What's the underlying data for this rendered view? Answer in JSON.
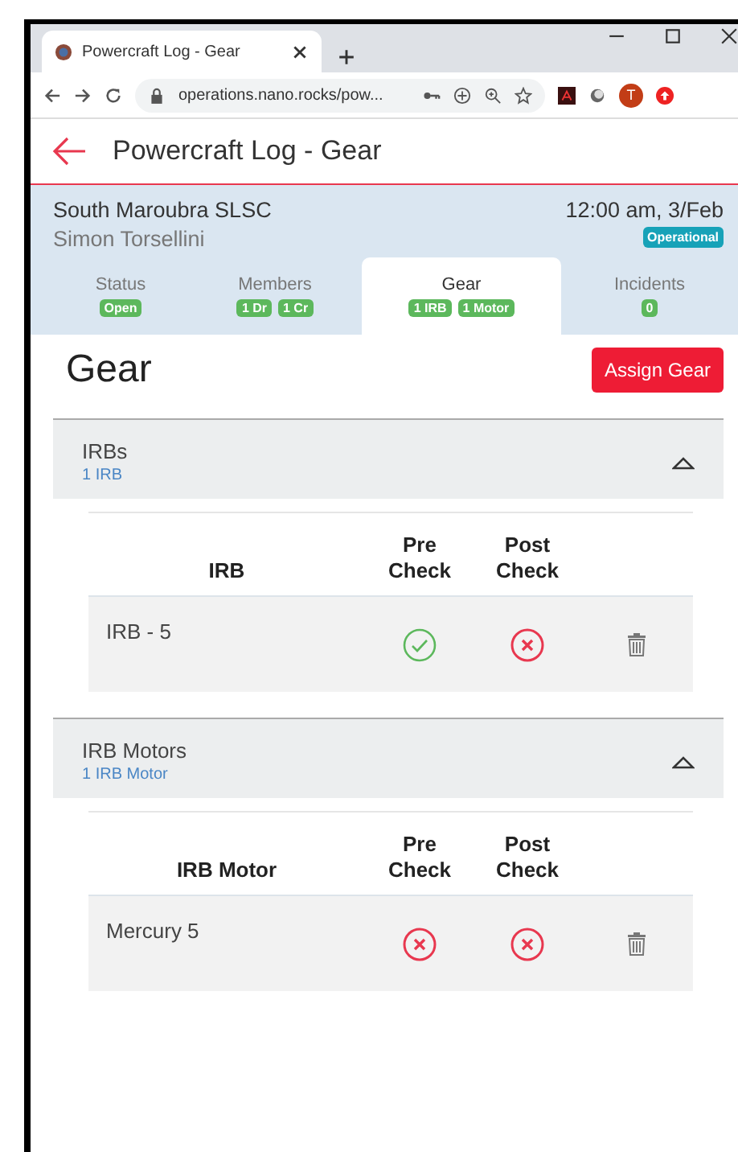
{
  "browser": {
    "tab_title": "Powercraft Log - Gear",
    "address": "operations.nano.rocks/pow...",
    "profile_initial": "T"
  },
  "app_bar": {
    "title": "Powercraft Log - Gear"
  },
  "info": {
    "club": "South Maroubra SLSC",
    "time": "12:00 am, 3/Feb",
    "person": "Simon Torsellini",
    "status_badge": "Operational"
  },
  "tabs": [
    {
      "label": "Status",
      "selected": false,
      "badges": [
        "Open"
      ]
    },
    {
      "label": "Members",
      "selected": false,
      "badges": [
        "1 Dr",
        "1 Cr"
      ]
    },
    {
      "label": "Gear",
      "selected": true,
      "badges": [
        "1 IRB",
        "1 Motor"
      ]
    },
    {
      "label": "Incidents",
      "selected": false,
      "badges": [
        "0"
      ]
    }
  ],
  "heading": "Gear",
  "assign_button": "Assign Gear",
  "sections": [
    {
      "title": "IRBs",
      "count": "1 IRB",
      "expanded": true,
      "columns": [
        "IRB",
        "Pre Check",
        "Post Check"
      ],
      "rows": [
        {
          "name": "IRB - 5",
          "pre_check": true,
          "post_check": false
        }
      ]
    },
    {
      "title": "IRB Motors",
      "count": "1 IRB Motor",
      "expanded": true,
      "columns": [
        "IRB Motor",
        "Pre Check",
        "Post Check"
      ],
      "rows": [
        {
          "name": "Mercury 5",
          "pre_check": false,
          "post_check": false
        }
      ]
    }
  ]
}
